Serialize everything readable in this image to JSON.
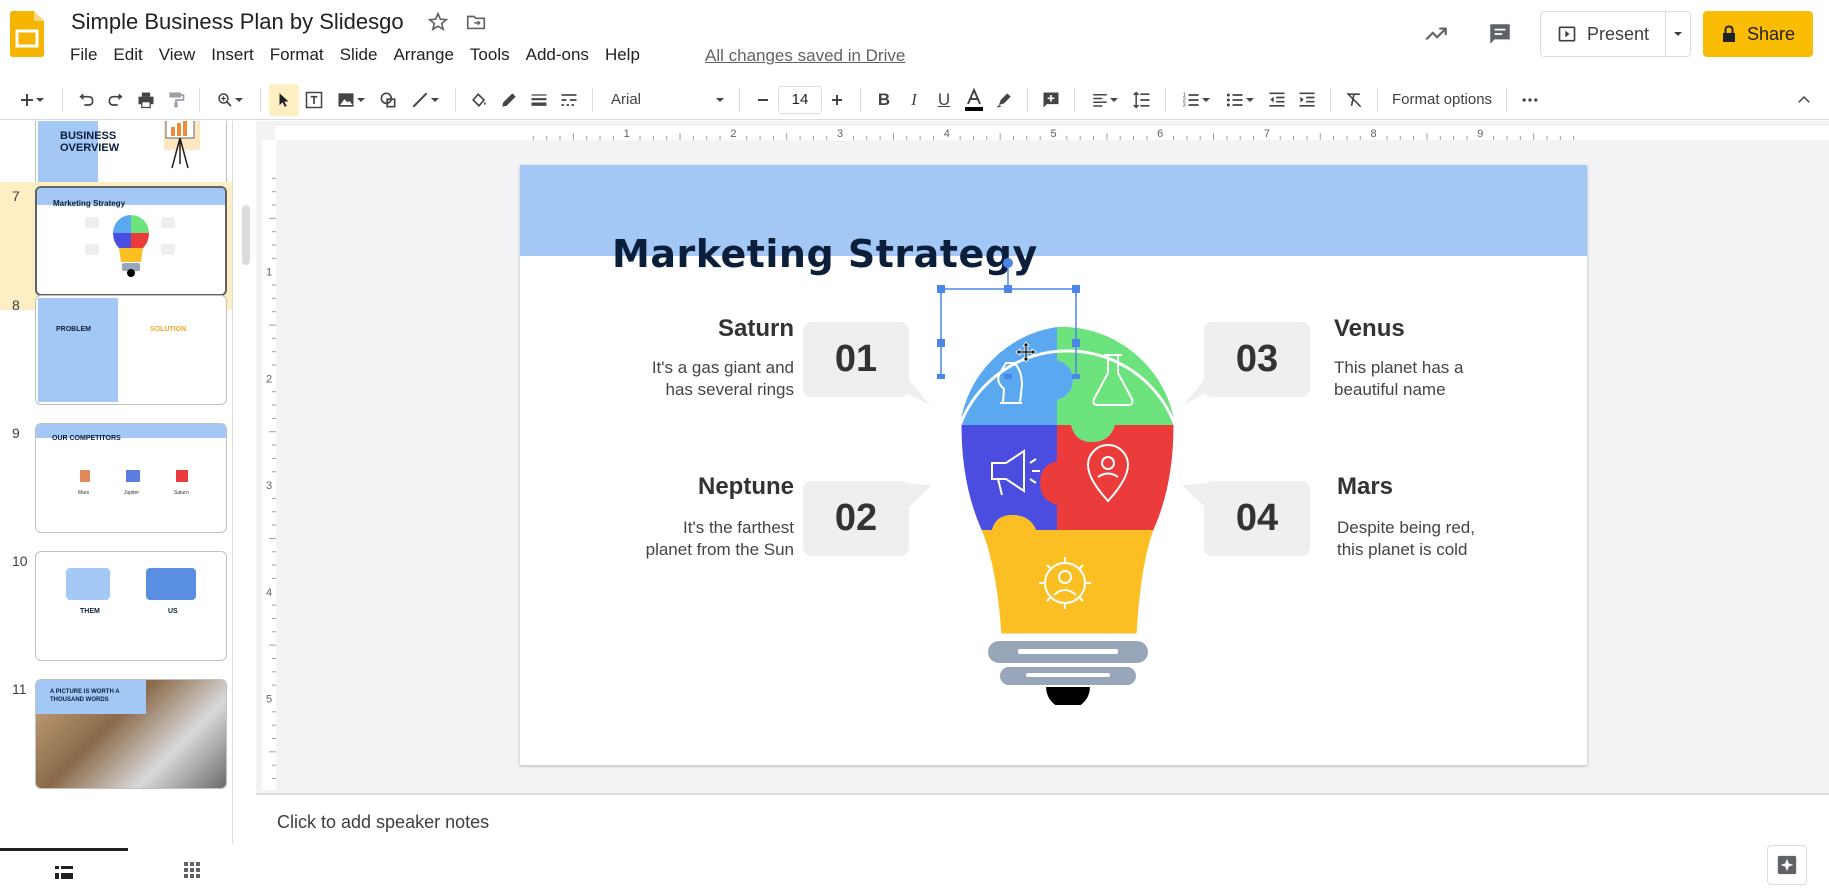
{
  "app": {
    "title": "Simple Business Plan by Slidesgo",
    "saved_status": "All changes saved in Drive",
    "present_label": "Present",
    "share_label": "Share"
  },
  "menu": [
    "File",
    "Edit",
    "View",
    "Insert",
    "Format",
    "Slide",
    "Arrange",
    "Tools",
    "Add-ons",
    "Help"
  ],
  "toolbar": {
    "font_name": "Arial",
    "font_size": "14",
    "format_options": "Format options"
  },
  "filmstrip": [
    {
      "num": "",
      "label": "BUSINESS OVERVIEW"
    },
    {
      "num": "7",
      "label": "Marketing Strategy",
      "selected": true
    },
    {
      "num": "8",
      "label": "PROBLEM",
      "label2": "SOLUTION"
    },
    {
      "num": "9",
      "label": "OUR COMPETITORS",
      "items": [
        "Mars",
        "Jupiter",
        "Saturn"
      ]
    },
    {
      "num": "10",
      "label": "THEM",
      "label2": "US"
    },
    {
      "num": "11",
      "label": "A PICTURE IS WORTH A THOUSAND WORDS"
    }
  ],
  "slide": {
    "title": "Marketing Strategy",
    "items": [
      {
        "num": "01",
        "title": "Saturn",
        "text1": "It's a gas giant and",
        "text2": "has several rings"
      },
      {
        "num": "02",
        "title": "Neptune",
        "text1": "It's the farthest",
        "text2": "planet from the Sun"
      },
      {
        "num": "03",
        "title": "Venus",
        "text1": "This planet has a",
        "text2": "beautiful name"
      },
      {
        "num": "04",
        "title": "Mars",
        "text1": "Despite being red,",
        "text2": "this planet is cold"
      }
    ],
    "colors": {
      "blue": "#5aa9f0",
      "green": "#6ce37d",
      "purple": "#4b4de0",
      "red": "#ec3b3b",
      "yellow": "#fbbf24",
      "band": "#a4c8f6"
    }
  },
  "ruler": {
    "h_ticks": [
      "1",
      "2",
      "3",
      "4",
      "5",
      "6",
      "7",
      "8",
      "9"
    ],
    "v_ticks": [
      "1",
      "2",
      "3",
      "4",
      "5"
    ]
  },
  "notes": {
    "placeholder": "Click to add speaker notes"
  }
}
